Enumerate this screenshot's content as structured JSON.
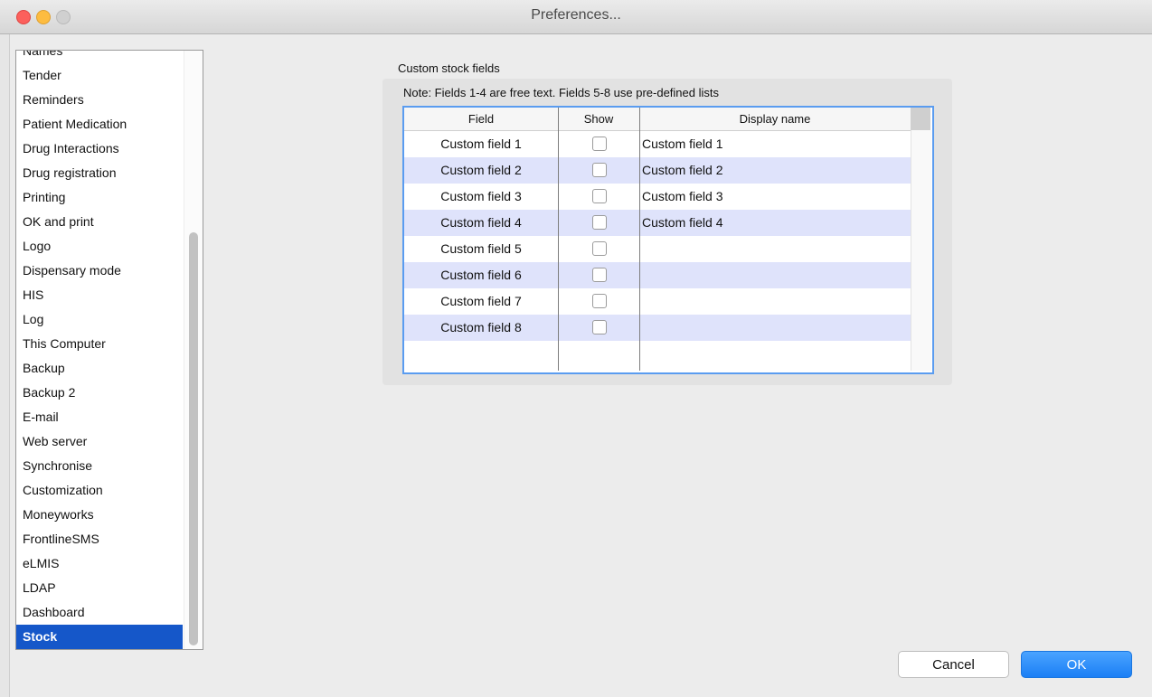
{
  "window": {
    "title": "Preferences..."
  },
  "sidebar": {
    "items": [
      {
        "label": "Names",
        "selected": false
      },
      {
        "label": "Tender",
        "selected": false
      },
      {
        "label": "Reminders",
        "selected": false
      },
      {
        "label": "Patient Medication",
        "selected": false
      },
      {
        "label": "Drug Interactions",
        "selected": false
      },
      {
        "label": "Drug registration",
        "selected": false
      },
      {
        "label": "Printing",
        "selected": false
      },
      {
        "label": "OK and print",
        "selected": false
      },
      {
        "label": "Logo",
        "selected": false
      },
      {
        "label": "Dispensary mode",
        "selected": false
      },
      {
        "label": "HIS",
        "selected": false
      },
      {
        "label": "Log",
        "selected": false
      },
      {
        "label": "This Computer",
        "selected": false
      },
      {
        "label": "Backup",
        "selected": false
      },
      {
        "label": "Backup 2",
        "selected": false
      },
      {
        "label": "E-mail",
        "selected": false
      },
      {
        "label": "Web server",
        "selected": false
      },
      {
        "label": "Synchronise",
        "selected": false
      },
      {
        "label": "Customization",
        "selected": false
      },
      {
        "label": "Moneyworks",
        "selected": false
      },
      {
        "label": "FrontlineSMS",
        "selected": false
      },
      {
        "label": "eLMIS",
        "selected": false
      },
      {
        "label": "LDAP",
        "selected": false
      },
      {
        "label": "Dashboard",
        "selected": false
      },
      {
        "label": "Stock",
        "selected": true
      }
    ]
  },
  "panel": {
    "group_label": "Custom stock fields",
    "note": "Note: Fields 1-4 are free text. Fields 5-8 use pre-defined lists",
    "table": {
      "columns": [
        "Field",
        "Show",
        "Display name"
      ],
      "rows": [
        {
          "field": "Custom field 1",
          "show": false,
          "display_name": "Custom field 1"
        },
        {
          "field": "Custom field 2",
          "show": false,
          "display_name": "Custom field 2"
        },
        {
          "field": "Custom field 3",
          "show": false,
          "display_name": "Custom field 3"
        },
        {
          "field": "Custom field 4",
          "show": false,
          "display_name": "Custom field 4"
        },
        {
          "field": "Custom field 5",
          "show": false,
          "display_name": ""
        },
        {
          "field": "Custom field 6",
          "show": false,
          "display_name": ""
        },
        {
          "field": "Custom field 7",
          "show": false,
          "display_name": ""
        },
        {
          "field": "Custom field 8",
          "show": false,
          "display_name": ""
        }
      ]
    }
  },
  "buttons": {
    "cancel_label": "Cancel",
    "ok_label": "OK"
  },
  "colors": {
    "selection": "#1557c9",
    "row_alt": "#dfe3fb",
    "focus_ring": "#5a9cf0",
    "ok_button": "#1b7ff5"
  }
}
